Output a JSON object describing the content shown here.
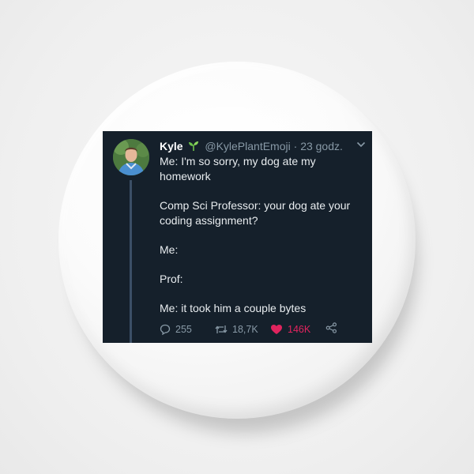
{
  "tweet": {
    "name": "Kyle",
    "handle": "@KylePlantEmoji",
    "separator": "·",
    "time": "23 godz.",
    "lines": [
      "Me: I'm so sorry, my dog ate my homework",
      "Comp Sci Professor: your dog ate your coding assignment?",
      "Me:",
      "Prof:",
      "Me: it took him a couple bytes"
    ],
    "replies": "255",
    "retweets": "18,7K",
    "likes": "146K",
    "name_emoji_icon": "seedling-icon"
  },
  "colors": {
    "tweet_background": "#15202b",
    "like_accent": "#e0245e",
    "muted_text": "#8899a6",
    "sprout": "#6cc24a"
  }
}
